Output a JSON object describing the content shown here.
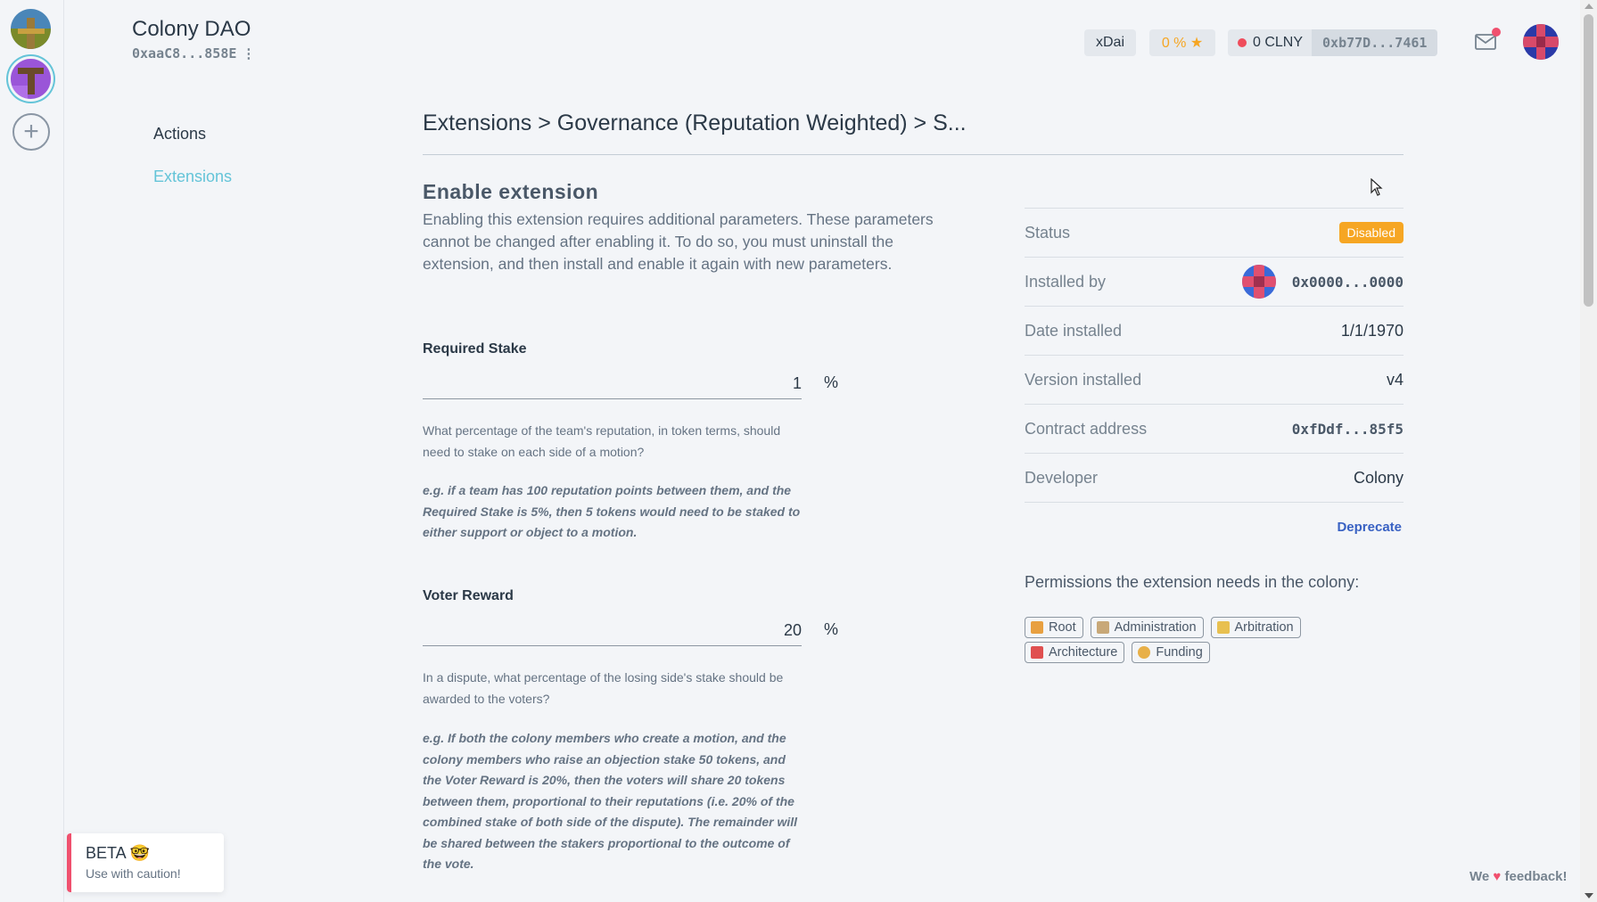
{
  "colony": {
    "name": "Colony DAO",
    "address": "0xaaC8...858E",
    "menu_icon": "⋮"
  },
  "header": {
    "network": "xDai",
    "reputation": "0 % ★",
    "balance": "0 CLNY",
    "wallet_address": "0xb77D...7461",
    "inbox_icon": "mail-icon",
    "inbox_badge_color": "#f0506e"
  },
  "nav": {
    "items": [
      {
        "label": "Actions"
      },
      {
        "label": "Extensions"
      }
    ]
  },
  "breadcrumb": "Extensions > Governance (Reputation Weighted) > S...",
  "enable": {
    "title": "Enable extension",
    "description": "Enabling this extension requires additional parameters. These parameters cannot be changed after enabling it. To do so, you must uninstall the extension, and then install and enable it again with new parameters."
  },
  "fields": [
    {
      "label": "Required Stake",
      "value": "1",
      "unit": "%",
      "help": "What percentage of the team's reputation, in token terms, should need to stake on each side of a motion?",
      "example": "e.g. if a team has 100 reputation points between them, and the Required Stake is 5%, then 5 tokens would need to be staked to either support or object to a motion."
    },
    {
      "label": "Voter Reward",
      "value": "20",
      "unit": "%",
      "help": "In a dispute, what percentage of the losing side's stake should be awarded to the voters?",
      "example": "e.g. If both the colony members who create a motion, and the colony members who raise an objection stake 50 tokens, and the Voter Reward is 20%, then the voters will share 20 tokens between them, proportional to their reputations (i.e. 20% of the combined stake of both side of the dispute). The remainder will be shared between the stakers proportional to the outcome of the vote."
    }
  ],
  "details": {
    "status_label": "Status",
    "status_value": "Disabled",
    "status_color": "#f6a623",
    "installed_by_label": "Installed by",
    "installed_by_value": "0x0000...0000",
    "date_label": "Date installed",
    "date_value": "1/1/1970",
    "version_label": "Version installed",
    "version_value": "v4",
    "contract_label": "Contract address",
    "contract_value": "0xfDdf...85f5",
    "developer_label": "Developer",
    "developer_value": "Colony",
    "deprecate_label": "Deprecate"
  },
  "permissions": {
    "title": "Permissions the extension needs in the colony:",
    "items": [
      {
        "label": "Root",
        "icon": "root-icon"
      },
      {
        "label": "Administration",
        "icon": "clipboard-icon"
      },
      {
        "label": "Arbitration",
        "icon": "scales-icon"
      },
      {
        "label": "Architecture",
        "icon": "crane-icon"
      },
      {
        "label": "Funding",
        "icon": "money-bag-icon"
      }
    ]
  },
  "beta": {
    "title": "BETA 🤓",
    "subtitle": "Use with caution!"
  },
  "feedback": {
    "prefix": "We",
    "heart": "♥",
    "suffix": "feedback!"
  }
}
